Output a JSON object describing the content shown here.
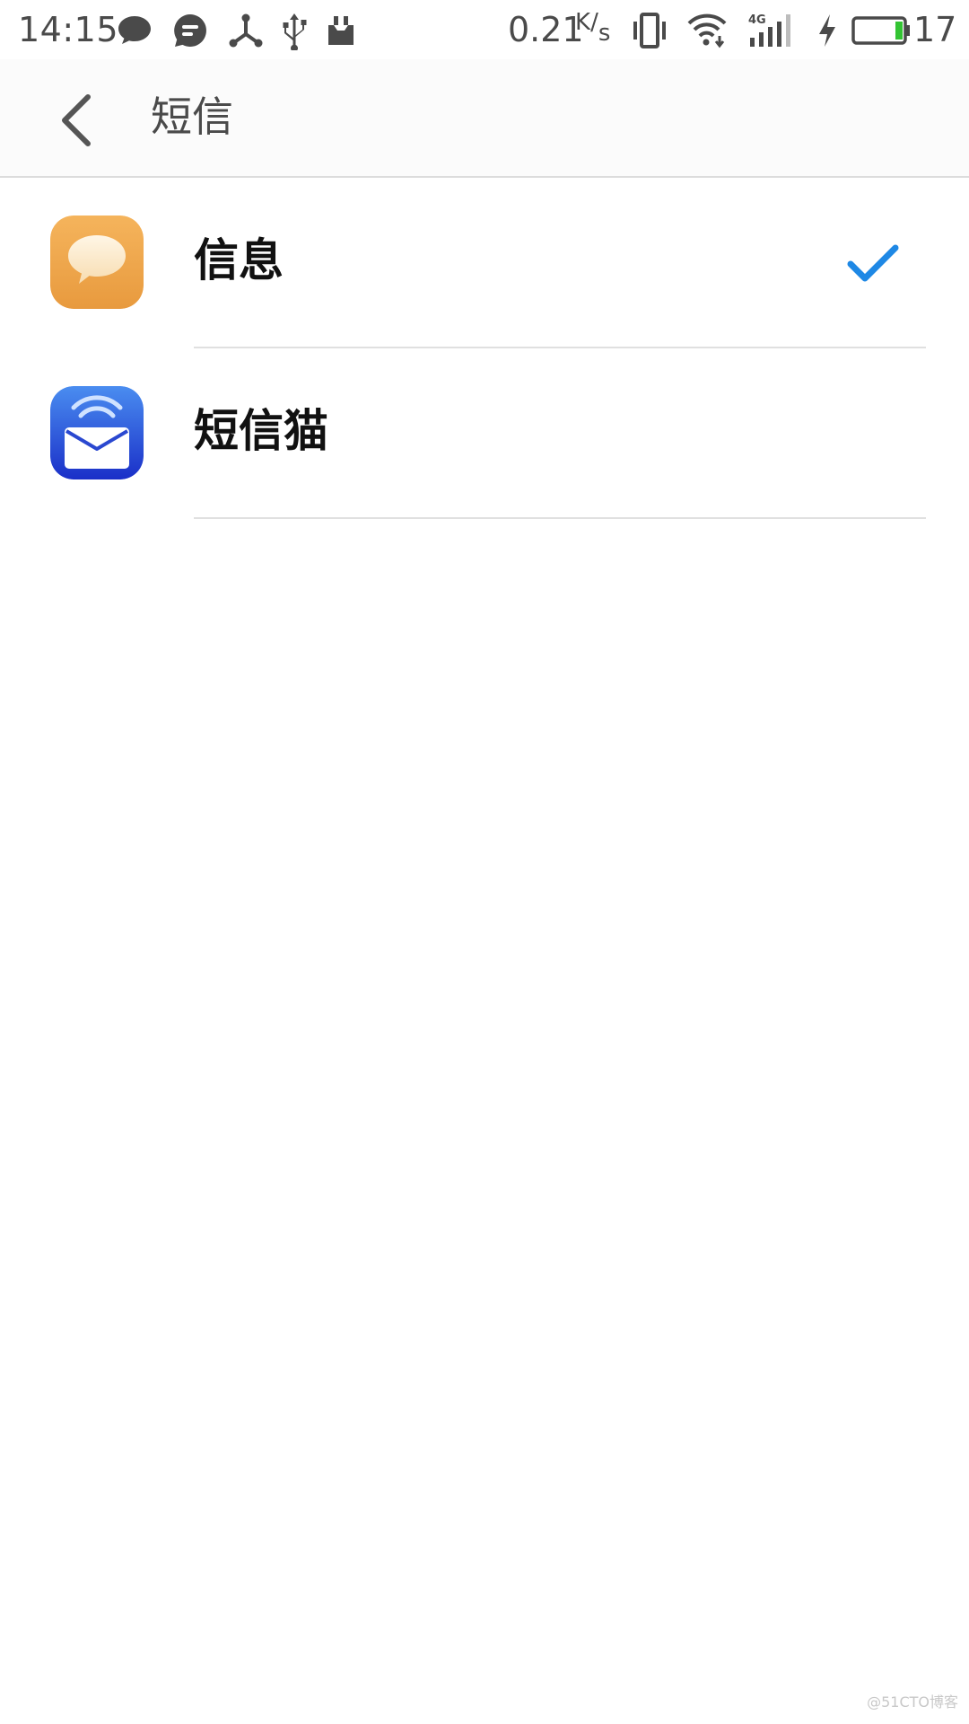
{
  "status_bar": {
    "time": "14:15",
    "net_speed_value": "0.21",
    "net_speed_unit_top": "K",
    "net_speed_unit_bottom": "s",
    "network_type": "4G",
    "battery_percent": "17",
    "icons": [
      "chat-bubble-icon",
      "message-app-icon",
      "share-hub-icon",
      "usb-icon",
      "clip-icon",
      "vibrate-icon",
      "wifi-icon",
      "signal-4g-icon",
      "charging-icon",
      "battery-icon"
    ]
  },
  "app_bar": {
    "title": "短信"
  },
  "apps": [
    {
      "label": "信息",
      "icon": "messages-app-icon",
      "selected": true
    },
    {
      "label": "短信猫",
      "icon": "sms-cat-app-icon",
      "selected": false
    }
  ],
  "colors": {
    "accent": "#1e88e5",
    "messages_icon": "#f0a848",
    "sms_cat_icon": "#1f49d6",
    "battery_fill": "#33c433"
  },
  "watermark": "@51CTO博客"
}
